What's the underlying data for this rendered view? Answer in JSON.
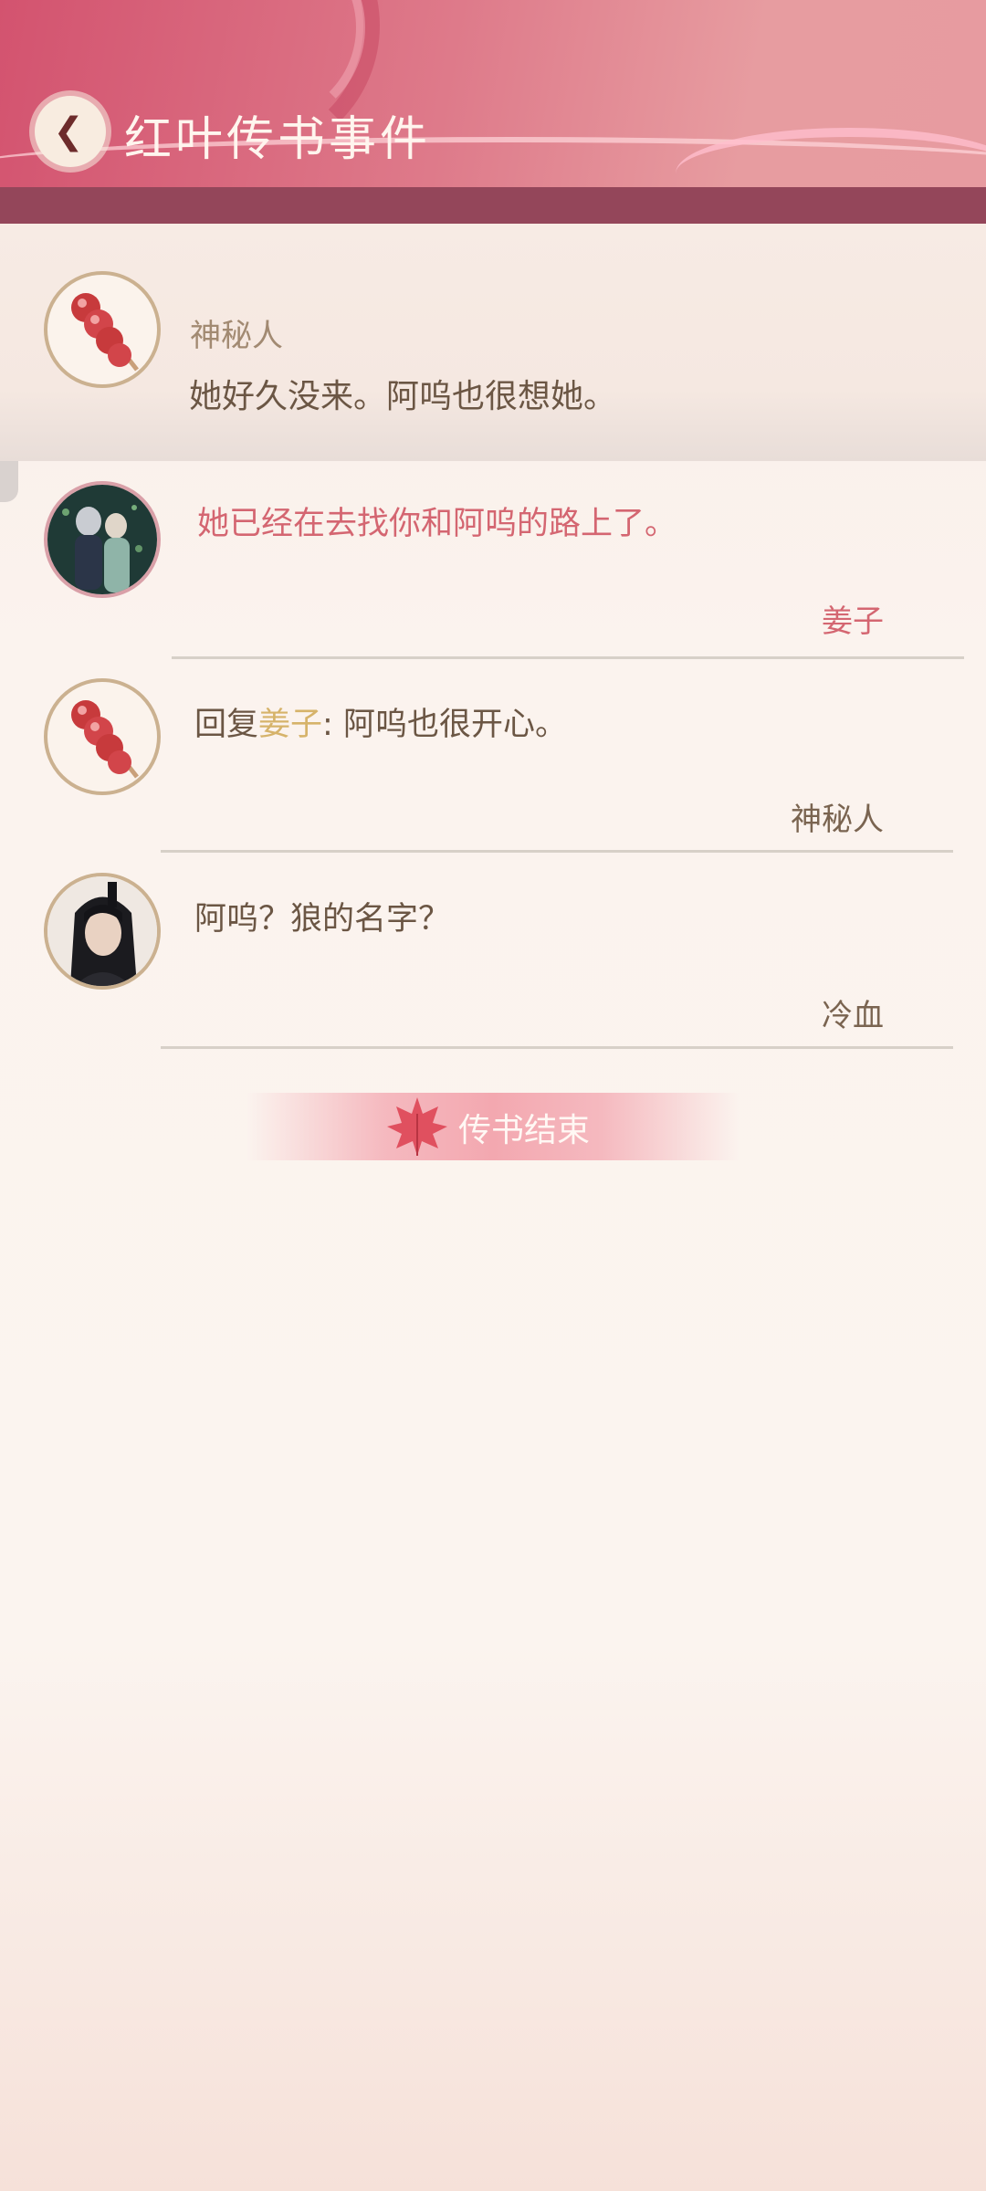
{
  "header": {
    "title": "红叶传书事件"
  },
  "post": {
    "author": "神秘人",
    "text": "她好久没来。阿呜也很想她。"
  },
  "comments": [
    {
      "text": "她已经在去找你和阿呜的路上了。",
      "author": "姜子"
    },
    {
      "reply_prefix": "回复",
      "reply_to": "姜子",
      "reply_text": ": 阿呜也很开心。",
      "author": "神秘人"
    },
    {
      "text": "阿呜？狼的名字？",
      "author": "冷血"
    }
  ],
  "end_label": "传书结束",
  "colors": {
    "accent_pink": "#d46671",
    "header": "#d3536f",
    "band": "#94465a",
    "reply_gold": "#d6b36a"
  }
}
